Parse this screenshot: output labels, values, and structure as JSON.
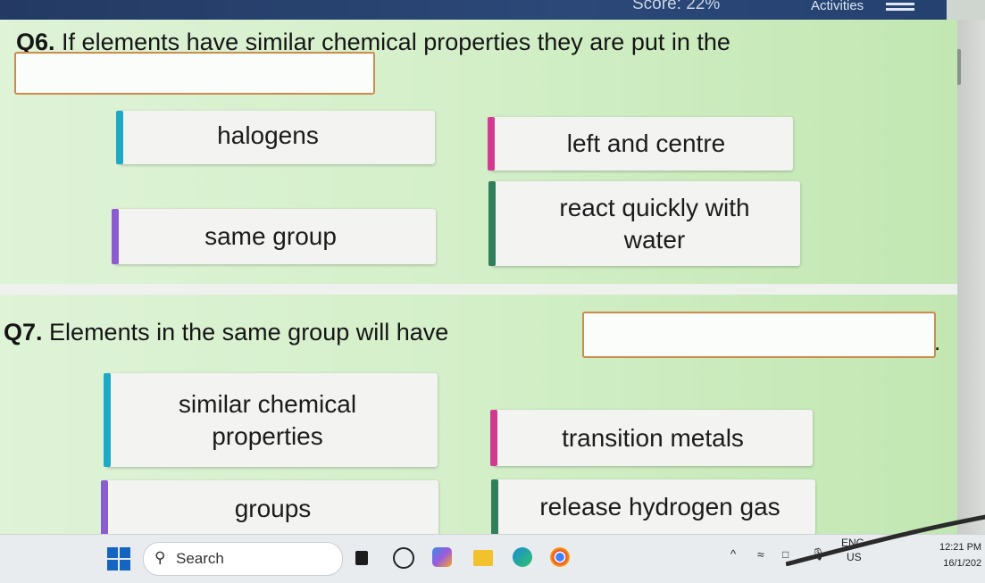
{
  "header": {
    "score": "Score: 22%",
    "activities_label": "Activities"
  },
  "q6": {
    "number": "Q6.",
    "text": "If elements have similar chemical properties they are put in the",
    "answers": [
      {
        "label": "halogens",
        "color": "#1fa9c7"
      },
      {
        "label": "left and centre",
        "color": "#d23a8f"
      },
      {
        "label": "react quickly with water",
        "color": "#2e7f5a"
      },
      {
        "label": "same group",
        "color": "#8a5cd0"
      }
    ]
  },
  "q7": {
    "number": "Q7.",
    "text": "Elements in the same group will have",
    "end": ".",
    "answers": [
      {
        "label": "similar chemical properties",
        "color": "#1fa9c7"
      },
      {
        "label": "transition metals",
        "color": "#d23a8f"
      },
      {
        "label": "groups",
        "color": "#8a5cd0"
      },
      {
        "label": "release hydrogen gas",
        "color": "#2e7f5a"
      }
    ]
  },
  "taskbar": {
    "search_placeholder": "Search",
    "apps": [
      "file-explorer-icon",
      "whatsapp-icon",
      "copilot-icon",
      "folder-icon",
      "edge-icon",
      "chrome-icon"
    ],
    "language": "ENG",
    "region": "US",
    "time": "12:21 PM",
    "date": "16/1/202"
  }
}
